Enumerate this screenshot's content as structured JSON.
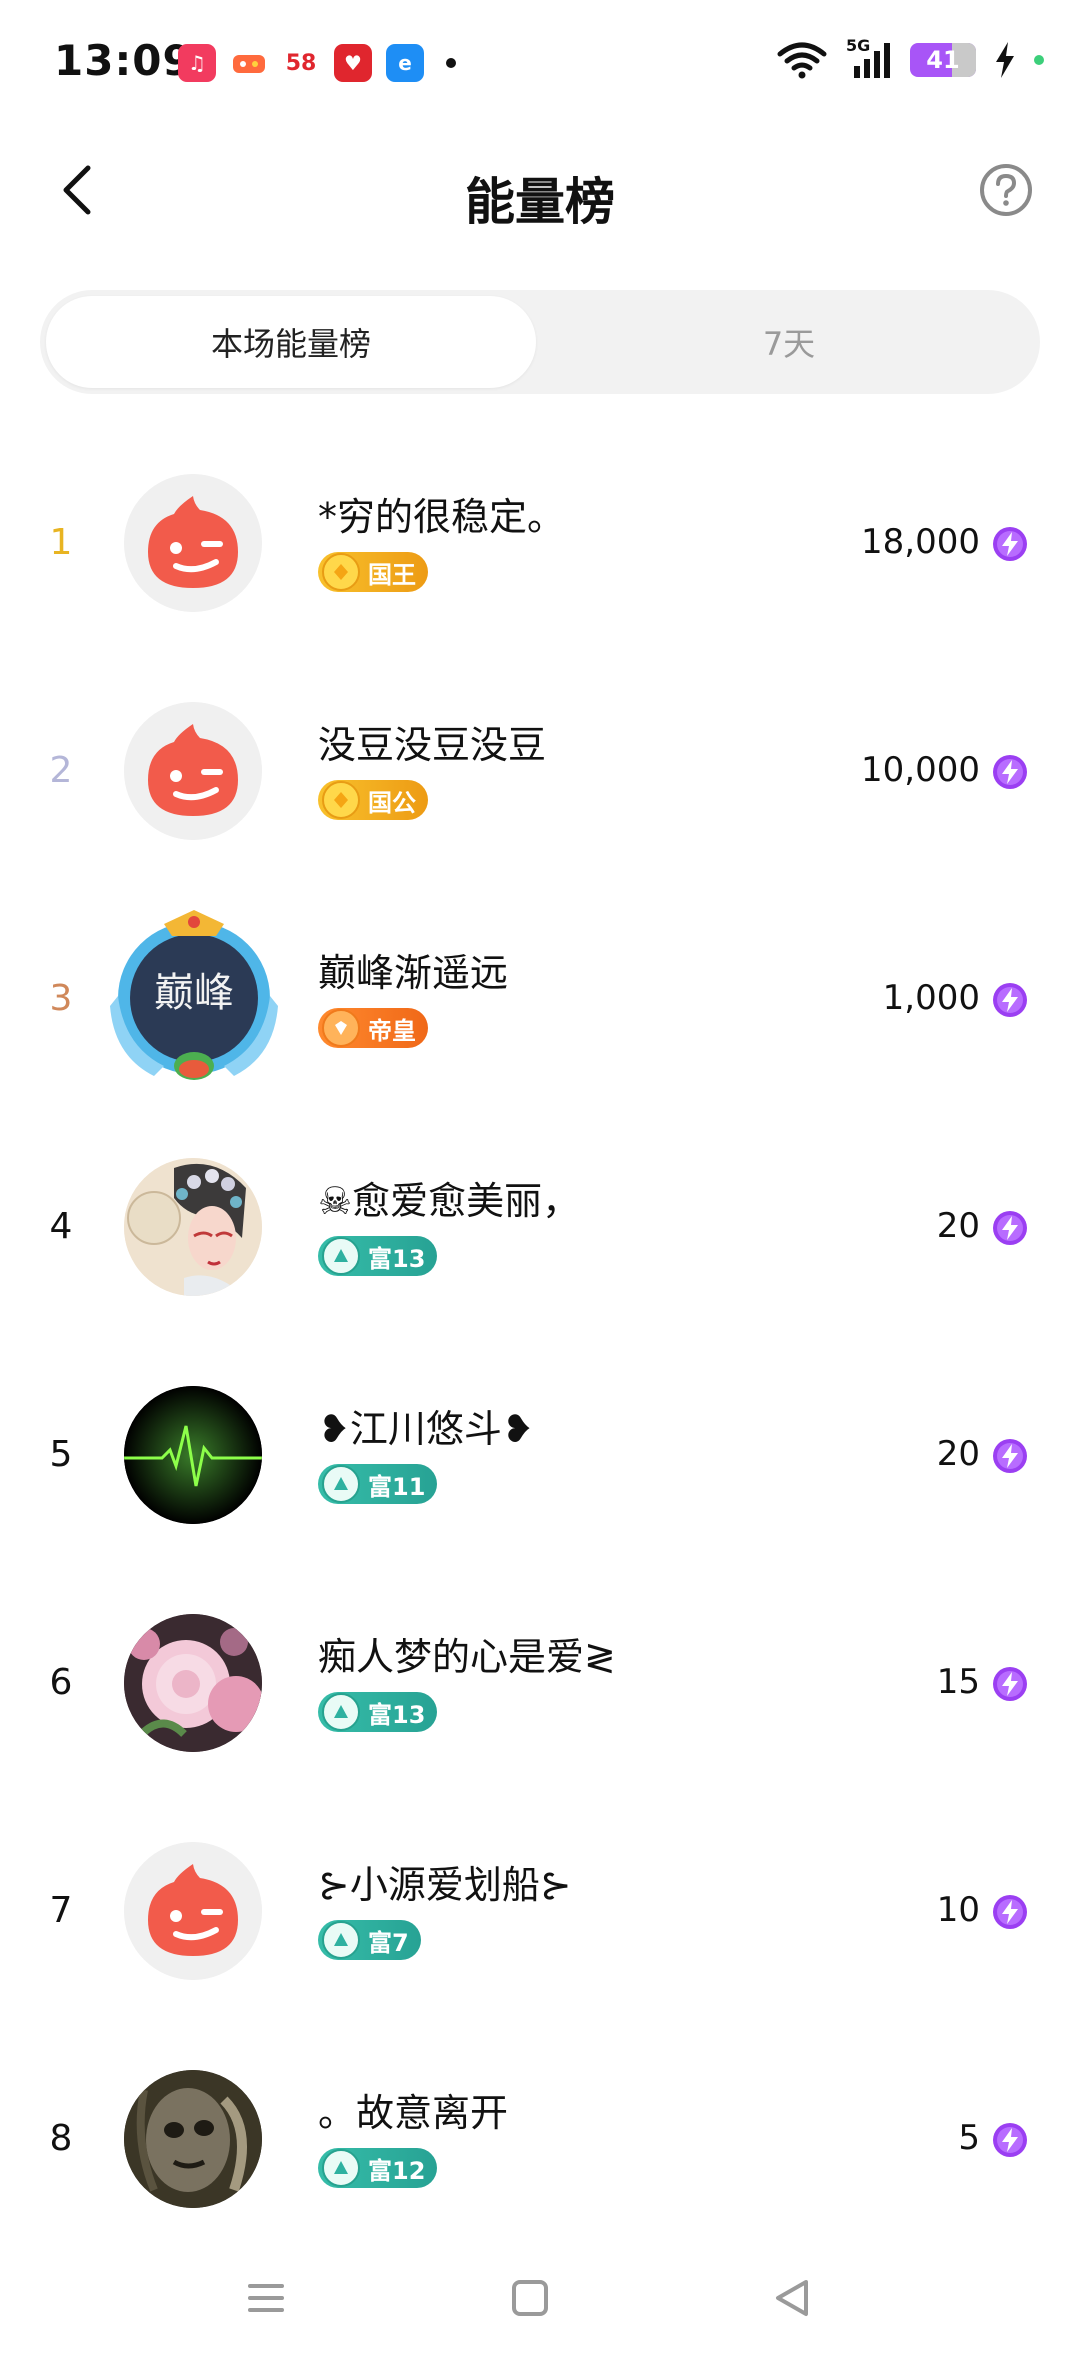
{
  "status_bar": {
    "time": "13:09",
    "notif_apps": [
      "music-app-icon",
      "game-app-icon",
      "58-app-icon",
      "shopping-app-icon",
      "e-app-icon"
    ],
    "notif_58_text": "58",
    "network": "5G",
    "battery": "41"
  },
  "header": {
    "title": "能量榜",
    "back_icon": "chevron-left-icon",
    "help_icon": "question-circle-icon"
  },
  "tabs": [
    {
      "label": "本场能量榜",
      "active": true
    },
    {
      "label": "7天",
      "active": false
    }
  ],
  "colors": {
    "rank1": "#e8b422",
    "rank2": "#b4b6d8",
    "rank3": "#d0885a",
    "default_avatar": "#f25b4b",
    "badge_gold": "#f0a71c",
    "badge_orange": "#f57c22",
    "badge_teal": "#2eb1a0",
    "energy": "#9b3ff2"
  },
  "leaderboard": [
    {
      "rank": "1",
      "name": "*穷的很稳定。",
      "badge": "国王",
      "score": "18,000",
      "avatar": "default-avatar"
    },
    {
      "rank": "2",
      "name": "没豆没豆没豆",
      "badge": "国公",
      "score": "10,000",
      "avatar": "default-avatar"
    },
    {
      "rank": "3",
      "name": "巅峰渐遥远",
      "badge": "帝皇",
      "score": "1,000",
      "avatar": "frame-avatar",
      "avatar_text": "巅峰"
    },
    {
      "rank": "4",
      "name": "☠愈爱愈美丽，",
      "badge": "富13",
      "score": "20",
      "avatar": "opera-avatar"
    },
    {
      "rank": "5",
      "name": "❥江川悠斗❥",
      "badge": "富11",
      "score": "20",
      "avatar": "heartbeat-avatar"
    },
    {
      "rank": "6",
      "name": "痴人梦的心是爱≷",
      "badge": "富13",
      "score": "15",
      "avatar": "flower-avatar"
    },
    {
      "rank": "7",
      "name": "⊱小源爱划船⊱",
      "badge": "富7",
      "score": "10",
      "avatar": "default-avatar"
    },
    {
      "rank": "8",
      "name": "。故意离开",
      "badge": "富12",
      "score": "5",
      "avatar": "dark-avatar"
    }
  ],
  "nav_bar": [
    "menu-icon",
    "home-square-icon",
    "back-triangle-icon"
  ]
}
